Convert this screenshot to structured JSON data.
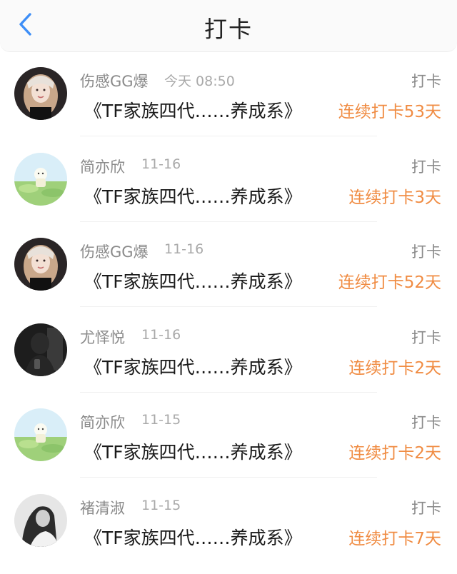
{
  "header": {
    "title": "打卡"
  },
  "items": [
    {
      "name": "伤感GG爆",
      "time": "今天 08:50",
      "action": "打卡",
      "content": "《TF家族四代……养成系》",
      "streak": "连续打卡53天",
      "avatar_icon": "girl-portrait-avatar"
    },
    {
      "name": "简亦欣",
      "time": "11-16",
      "action": "打卡",
      "content": "《TF家族四代……养成系》",
      "streak": "连续打卡3天",
      "avatar_icon": "cartoon-meadow-avatar"
    },
    {
      "name": "伤感GG爆",
      "time": "11-16",
      "action": "打卡",
      "content": "《TF家族四代……养成系》",
      "streak": "连续打卡52天",
      "avatar_icon": "girl-portrait-avatar"
    },
    {
      "name": "尤怿悦",
      "time": "11-16",
      "action": "打卡",
      "content": "《TF家族四代……养成系》",
      "streak": "连续打卡2天",
      "avatar_icon": "dark-selfie-avatar"
    },
    {
      "name": "简亦欣",
      "time": "11-15",
      "action": "打卡",
      "content": "《TF家族四代……养成系》",
      "streak": "连续打卡2天",
      "avatar_icon": "cartoon-meadow-avatar"
    },
    {
      "name": "褚清淑",
      "time": "11-15",
      "action": "打卡",
      "content": "《TF家族四代……养成系》",
      "streak": "连续打卡7天",
      "avatar_icon": "bw-portrait-avatar"
    }
  ],
  "colors": {
    "accent_blue": "#3d8ef7",
    "streak_orange": "#f08c43",
    "name_gray": "#8a8a8a"
  }
}
